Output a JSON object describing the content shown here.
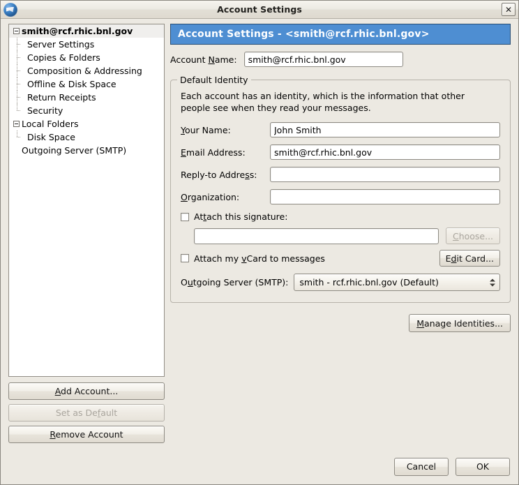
{
  "window": {
    "title": "Account Settings",
    "icon": "thunderbird-icon",
    "close_label": "✕"
  },
  "sidebar": {
    "tree": [
      {
        "label": "smith@rcf.rhic.bnl.gov",
        "level": 0,
        "selected": true,
        "twisty": "minus"
      },
      {
        "label": "Server Settings",
        "level": 1,
        "selected": false,
        "twisty": "none"
      },
      {
        "label": "Copies & Folders",
        "level": 1,
        "selected": false,
        "twisty": "none"
      },
      {
        "label": "Composition & Addressing",
        "level": 1,
        "selected": false,
        "twisty": "none"
      },
      {
        "label": "Offline & Disk Space",
        "level": 1,
        "selected": false,
        "twisty": "none"
      },
      {
        "label": "Return Receipts",
        "level": 1,
        "selected": false,
        "twisty": "none"
      },
      {
        "label": "Security",
        "level": 1,
        "selected": false,
        "twisty": "none",
        "last": true
      },
      {
        "label": "Local Folders",
        "level": 0,
        "selected": false,
        "twisty": "minus"
      },
      {
        "label": "Disk Space",
        "level": 1,
        "selected": false,
        "twisty": "none",
        "last": true
      },
      {
        "label": "Outgoing Server (SMTP)",
        "level": 0,
        "selected": false,
        "twisty": "none"
      }
    ],
    "buttons": {
      "add_account": "Add Account...",
      "add_account_key": "A",
      "set_as_default": "Set as Default",
      "set_as_default_key": "f",
      "set_as_default_disabled": true,
      "remove_account": "Remove Account",
      "remove_account_key": "R"
    }
  },
  "panel": {
    "header": "Account Settings - <smith@rcf.rhic.bnl.gov>",
    "account_name_label_pre": "Account ",
    "account_name_label_key": "N",
    "account_name_label_post": "ame:",
    "account_name_value": "smith@rcf.rhic.bnl.gov",
    "identity": {
      "title": "Default Identity",
      "description": "Each account has an identity, which is the information that other people see when they read your messages.",
      "your_name_label_pre": "",
      "your_name_label_key": "Y",
      "your_name_label_post": "our Name:",
      "your_name_value": "John Smith",
      "email_label_pre": "",
      "email_label_key": "E",
      "email_label_post": "mail Address:",
      "email_value": "smith@rcf.rhic.bnl.gov",
      "reply_to_label_pre": "Reply-to Addre",
      "reply_to_label_key": "s",
      "reply_to_label_post": "s:",
      "reply_to_value": "",
      "organization_label_pre": "",
      "organization_label_key": "O",
      "organization_label_post": "rganization:",
      "organization_value": "",
      "attach_signature_pre": "At",
      "attach_signature_key": "t",
      "attach_signature_post": "ach this signature:",
      "attach_signature_checked": false,
      "signature_path_value": "",
      "choose_label_pre": "",
      "choose_label_key": "C",
      "choose_label_post": "hoose...",
      "choose_disabled": true,
      "attach_vcard_pre": "Attach my ",
      "attach_vcard_key": "v",
      "attach_vcard_post": "Card to messages",
      "attach_vcard_checked": false,
      "edit_card_pre": "E",
      "edit_card_key": "d",
      "edit_card_post": "it Card...",
      "smtp_label_pre": "O",
      "smtp_label_key": "u",
      "smtp_label_post": "tgoing Server (SMTP):",
      "smtp_value": "smith - rcf.rhic.bnl.gov  (Default)"
    },
    "manage_identities_pre": "",
    "manage_identities_key": "M",
    "manage_identities_post": "anage Identities..."
  },
  "footer": {
    "cancel": "Cancel",
    "ok": "OK"
  },
  "colors": {
    "header_blue": "#4e8ed2",
    "window_bg": "#ece9e2",
    "field_bg": "#ffffff"
  }
}
